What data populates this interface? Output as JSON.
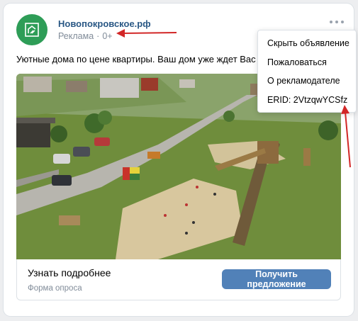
{
  "post": {
    "author": "Новопокровское.рф",
    "ad_label": "Реклама",
    "age_rating": "0+",
    "text": "Уютные дома по цене квартиры. Ваш дом уже ждет Вас"
  },
  "footer": {
    "learn_more": "Узнать подробнее",
    "form_type": "Форма опроса",
    "cta_button": "Получить предложение"
  },
  "menu": {
    "items": [
      {
        "label": "Скрыть объявление"
      },
      {
        "label": "Пожаловаться"
      },
      {
        "label": "О рекламодателе"
      },
      {
        "label": "ERID: 2VtzqwYCSfz"
      }
    ]
  },
  "icons": {
    "avatar": "house-logo-icon",
    "more": "more-dots-icon"
  },
  "colors": {
    "background": "#edeef0",
    "avatar_green": "#2e9d57",
    "link_blue": "#2a5885",
    "button_blue": "#5181b8",
    "annotation_red": "#d22727"
  }
}
